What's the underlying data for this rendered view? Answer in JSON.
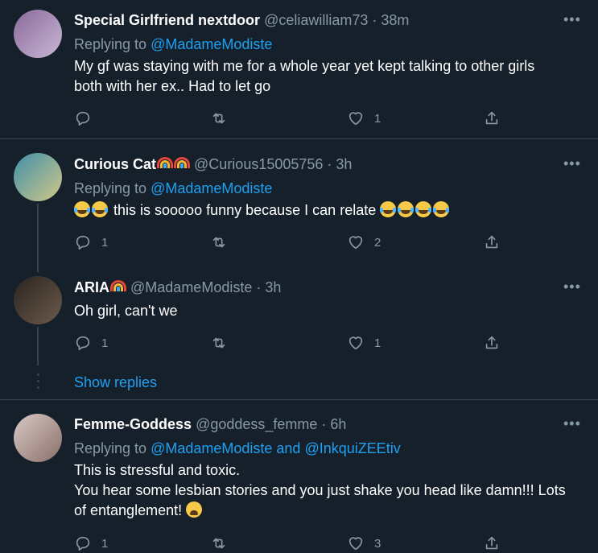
{
  "tweets": [
    {
      "name": "Special Girlfriend nextdoor",
      "handle": "@celiawilliam73",
      "time": "38m",
      "replying_label": "Replying to ",
      "replying_to": "@MadameModiste",
      "text_lines": [
        "My gf was staying with me for a whole year yet kept talking to other girls",
        "both with her ex.. Had to let go"
      ],
      "reply_count": "",
      "retweet_count": "",
      "like_count": "1",
      "avatar_colors": [
        "#8a6a9a",
        "#c9b7d6"
      ]
    },
    {
      "name": "Curious Cat",
      "handle": "@Curious15005756",
      "time": "3h",
      "replying_label": "Replying to ",
      "replying_to": "@MadameModiste",
      "text": "this is sooooo funny because I can relate",
      "reply_count": "1",
      "retweet_count": "",
      "like_count": "2",
      "avatar_colors": [
        "#3f8fa8",
        "#d2c88a"
      ]
    },
    {
      "name": "ARIA",
      "handle": "@MadameModiste",
      "time": "3h",
      "text": "Oh girl, can't we",
      "reply_count": "1",
      "retweet_count": "",
      "like_count": "1",
      "avatar_colors": [
        "#2b2420",
        "#6b5a4a"
      ]
    },
    {
      "name": "Femme-Goddess",
      "handle": "@goddess_femme",
      "time": "6h",
      "replying_label": "Replying to ",
      "replying_to": "@MadameModiste",
      "replying_and": " and ",
      "replying_to_2": "@InkquiZEEtiv",
      "text_lines": [
        "This is stressful and toxic.",
        "You hear some lesbian stories and you just shake you head like damn!!! Lots",
        "of entanglement!"
      ],
      "reply_count": "1",
      "retweet_count": "",
      "like_count": "3",
      "avatar_colors": [
        "#d9c9c4",
        "#8a6f6a"
      ]
    }
  ],
  "show_replies": "Show replies",
  "more_glyph": "•••",
  "sep": " · ",
  "icons": [
    "reply-icon",
    "retweet-icon",
    "like-icon",
    "share-icon",
    "more-icon"
  ],
  "colors": {
    "background": "#15202b",
    "link": "#1da1f2",
    "muted": "#8899a6",
    "divider": "#38444d"
  }
}
